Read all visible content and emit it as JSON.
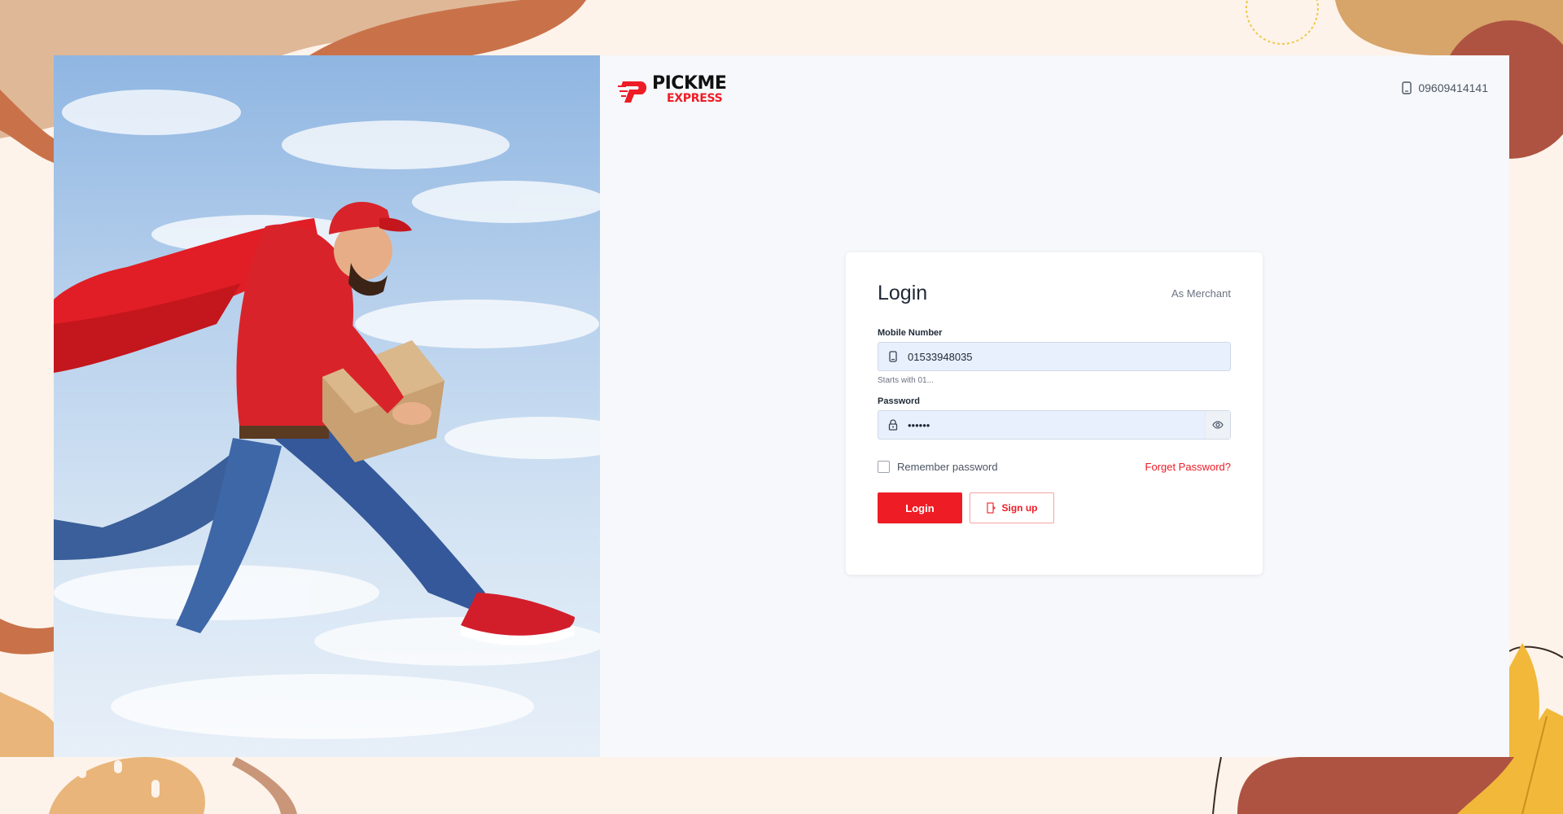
{
  "header": {
    "brand_name": "PICKME",
    "brand_sub": "EXPRESS",
    "hotline": "09609414141"
  },
  "login": {
    "title": "Login",
    "role_label": "As Merchant",
    "mobile_label": "Mobile Number",
    "mobile_value": "01533948035",
    "mobile_hint": "Starts with 01...",
    "password_label": "Password",
    "password_value": "••••••",
    "remember_label": "Remember password",
    "remember_checked": false,
    "forget_label": "Forget Password?",
    "login_button": "Login",
    "signup_button": "Sign up"
  },
  "colors": {
    "accent": "#ee1c25",
    "page_bg": "#fdf3ea",
    "panel_bg": "#f6f8fb",
    "input_bg": "#e8f0fe"
  },
  "icons": {
    "hotline": "mobile-phone-icon",
    "mobile_field": "mobile-phone-icon",
    "password_field": "lock-icon",
    "password_toggle": "eye-icon",
    "signup": "door-exit-icon"
  }
}
